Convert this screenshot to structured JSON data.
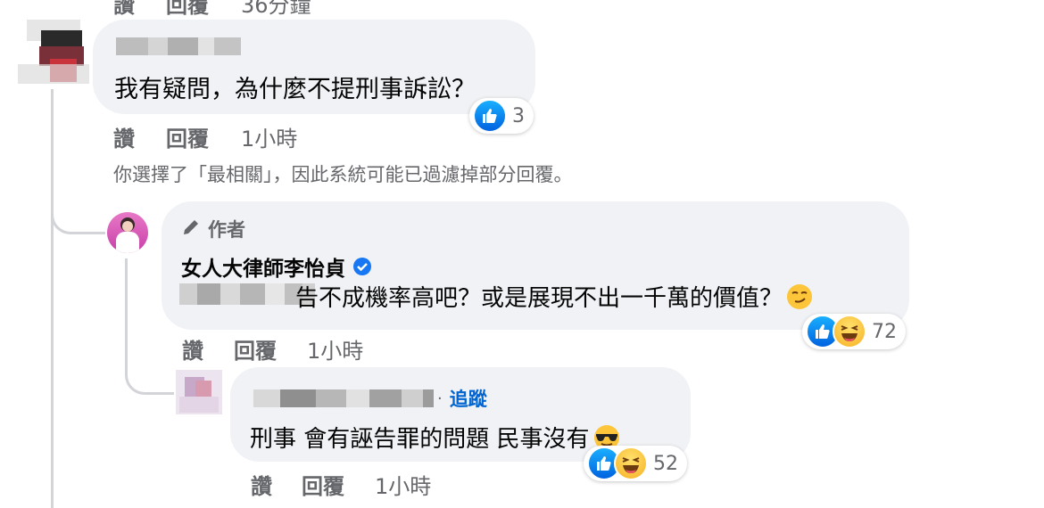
{
  "top_partial": {
    "like_label": "讚",
    "reply_label": "回覆",
    "time": "36分鐘"
  },
  "comment1": {
    "text": "我有疑問，為什麼不提刑事訴訟？",
    "reaction_count": "3",
    "like_label": "讚",
    "reply_label": "回覆",
    "time": "1小時"
  },
  "notice": "你選擇了「最相關」，因此系統可能已過濾掉部分回覆。",
  "author_reply": {
    "badge": "作者",
    "name": "女人大律師李怡貞",
    "text": "告不成機率高吧？或是展現不出一千萬的價值？",
    "reaction_count": "72",
    "like_label": "讚",
    "reply_label": "回覆",
    "time": "1小時"
  },
  "nested_reply": {
    "follow_label": "追蹤",
    "separator": "·",
    "text": "刑事 會有誣告罪的問題 民事沒有",
    "reaction_count": "52",
    "like_label": "讚",
    "reply_label": "回覆",
    "time": "1小時"
  },
  "colors": {
    "bubble": "#f0f2f5",
    "link": "#0064d1",
    "verified": "#1877f2",
    "muted": "#65676b",
    "like": "#1877f2",
    "haha": "#f7b125"
  },
  "icons": {
    "like": "thumbs-up-icon",
    "haha": "laughing-face-icon",
    "pen": "pencil-icon",
    "verified": "verified-badge-icon",
    "smirk": "smirk-emoji-icon",
    "cool": "sunglasses-emoji-icon"
  }
}
